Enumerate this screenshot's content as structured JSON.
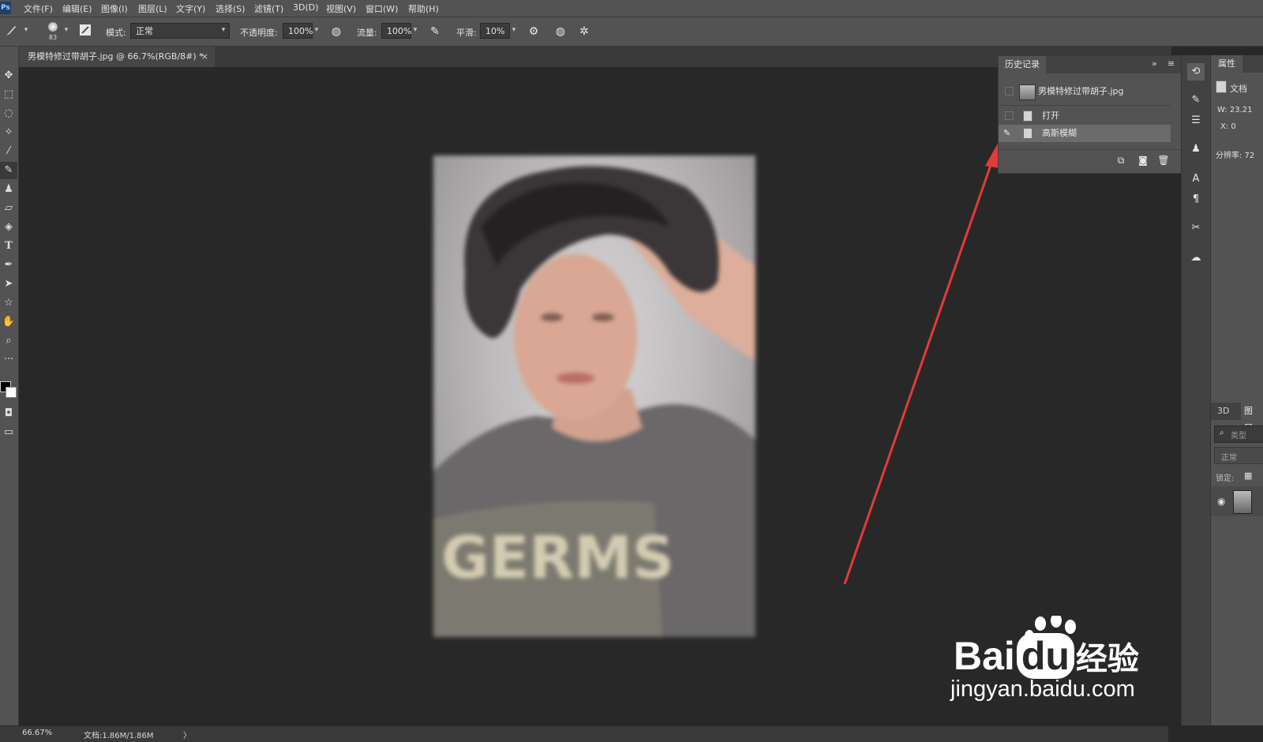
{
  "app": {
    "logo_text": "Ps",
    "menu": [
      "文件(F)",
      "编辑(E)",
      "图像(I)",
      "图层(L)",
      "文字(Y)",
      "选择(S)",
      "滤镜(T)",
      "3D(D)",
      "视图(V)",
      "窗口(W)",
      "帮助(H)"
    ]
  },
  "options_bar": {
    "brush_size": "83",
    "mode_label": "模式:",
    "mode_value": "正常",
    "opacity_label": "不透明度:",
    "opacity_value": "100%",
    "flow_label": "流量:",
    "flow_value": "100%",
    "smoothing_label": "平滑:",
    "smoothing_value": "10%"
  },
  "document_tab": {
    "title": "男模特修过带胡子.jpg @ 66.7%(RGB/8#) *",
    "close": "×"
  },
  "history_panel": {
    "tab": "历史记录",
    "items": [
      {
        "label": "男模特修过带胡子.jpg",
        "type": "snapshot"
      },
      {
        "label": "打开",
        "type": "step"
      },
      {
        "label": "高斯模糊",
        "type": "step",
        "selected": true
      }
    ]
  },
  "properties_panel": {
    "tab": "属性",
    "doc_label": "文档",
    "width": "W: 23.21",
    "x": "X: 0",
    "resolution": "分辨率: 72"
  },
  "layers_panel": {
    "tabs": [
      "3D",
      "图层"
    ],
    "search_placeholder": "类型",
    "blend_mode": "正常",
    "lock_label": "锁定:"
  },
  "status_bar": {
    "zoom": "66.67%",
    "doc_info": "文档:1.86M/1.86M",
    "arrow": "〉"
  },
  "photo": {
    "shirt_text": "GERMS"
  },
  "watermark": {
    "brand": "Bai",
    "brand_du": "du",
    "brand_cn": "经验",
    "url": "jingyan.baidu.com"
  },
  "colors": {
    "accent_arrow": "#e33a3a",
    "panel_bg": "#535353",
    "canvas_bg": "#282828"
  }
}
